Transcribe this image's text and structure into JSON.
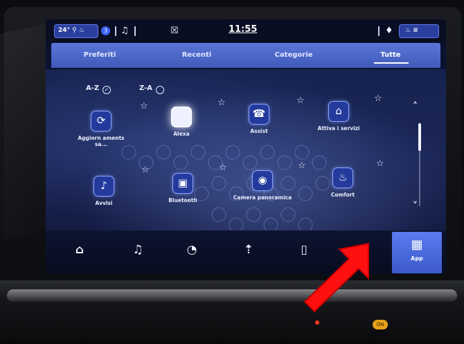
{
  "status_bar": {
    "left_pill_text": "24° ⚲ ♨",
    "notif_badge": "3",
    "bell_icon": "bell-icon",
    "climate_icon": "seat-climate-icon",
    "time": "11:55",
    "mic_icon": "mic-icon",
    "right_pill_text": "♨ ≡"
  },
  "tabs": [
    {
      "label": "Preferiti"
    },
    {
      "label": "Recenti"
    },
    {
      "label": "Categorie"
    },
    {
      "label": "Tutte"
    }
  ],
  "active_tab": 3,
  "sort": {
    "az_label": "A-Z",
    "za_label": "Z-A",
    "az_mark": "✓"
  },
  "apps_row1": [
    {
      "label": "Aggiorn aments sa...",
      "icon": "update-icon",
      "glyph": "⟳"
    },
    {
      "label": "Alexa",
      "icon": "alexa-icon",
      "glyph": ""
    },
    {
      "label": "Assist",
      "icon": "assist-icon",
      "glyph": "☎"
    },
    {
      "label": "Attiva i servizi",
      "icon": "activate-services-icon",
      "glyph": "⌂"
    }
  ],
  "apps_row2": [
    {
      "label": "Avvisi",
      "icon": "alerts-bell-icon",
      "glyph": "♪"
    },
    {
      "label": "Bluetooth",
      "icon": "bluetooth-icon",
      "glyph": "▣"
    },
    {
      "label": "Camera panoramica",
      "icon": "panoramic-camera-icon",
      "glyph": "◉"
    },
    {
      "label": "Comfort",
      "icon": "comfort-seat-icon",
      "glyph": "♨"
    }
  ],
  "star_glyph": "☆",
  "scroll": {
    "up": "˄",
    "down": "˅"
  },
  "nav": {
    "home": "⌂",
    "media": "♫",
    "comfort": "◔",
    "navigation": "⇡",
    "phone": "▯",
    "vehicle": "▤",
    "apps_grid": "▦",
    "apps_label": "App"
  },
  "dash_knob_text": "ON"
}
